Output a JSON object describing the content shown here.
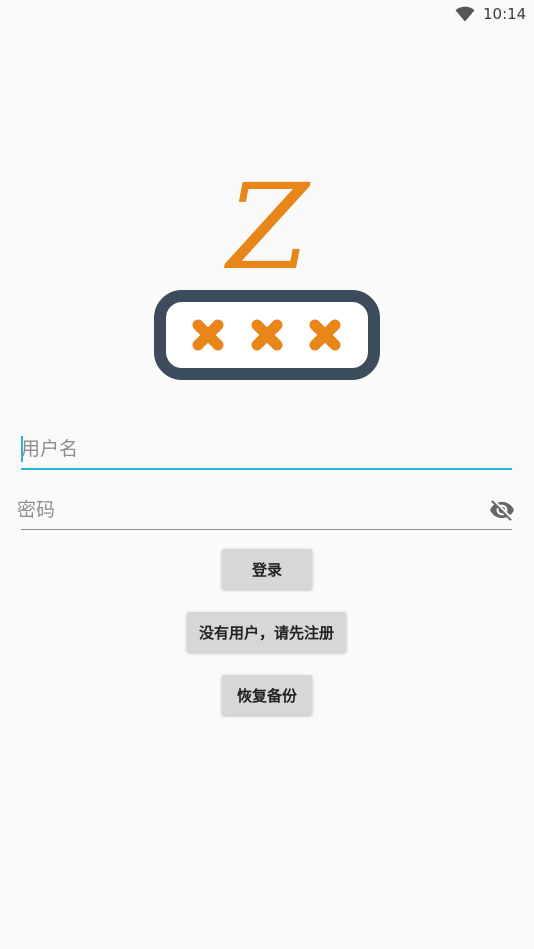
{
  "status_bar": {
    "time": "10:14",
    "wifi_icon": "wifi-icon"
  },
  "logo": {
    "letter": "Z",
    "accent_color": "#e8861a",
    "frame_color": "#3c4c5c"
  },
  "form": {
    "username_placeholder": "用户名",
    "password_placeholder": "密码",
    "visibility_icon": "eye-off-icon"
  },
  "buttons": {
    "login": "登录",
    "register": "没有用户，请先注册",
    "restore": "恢复备份"
  },
  "colors": {
    "focus_underline": "#2bb4d6",
    "button_bg": "#d6d7d7"
  }
}
